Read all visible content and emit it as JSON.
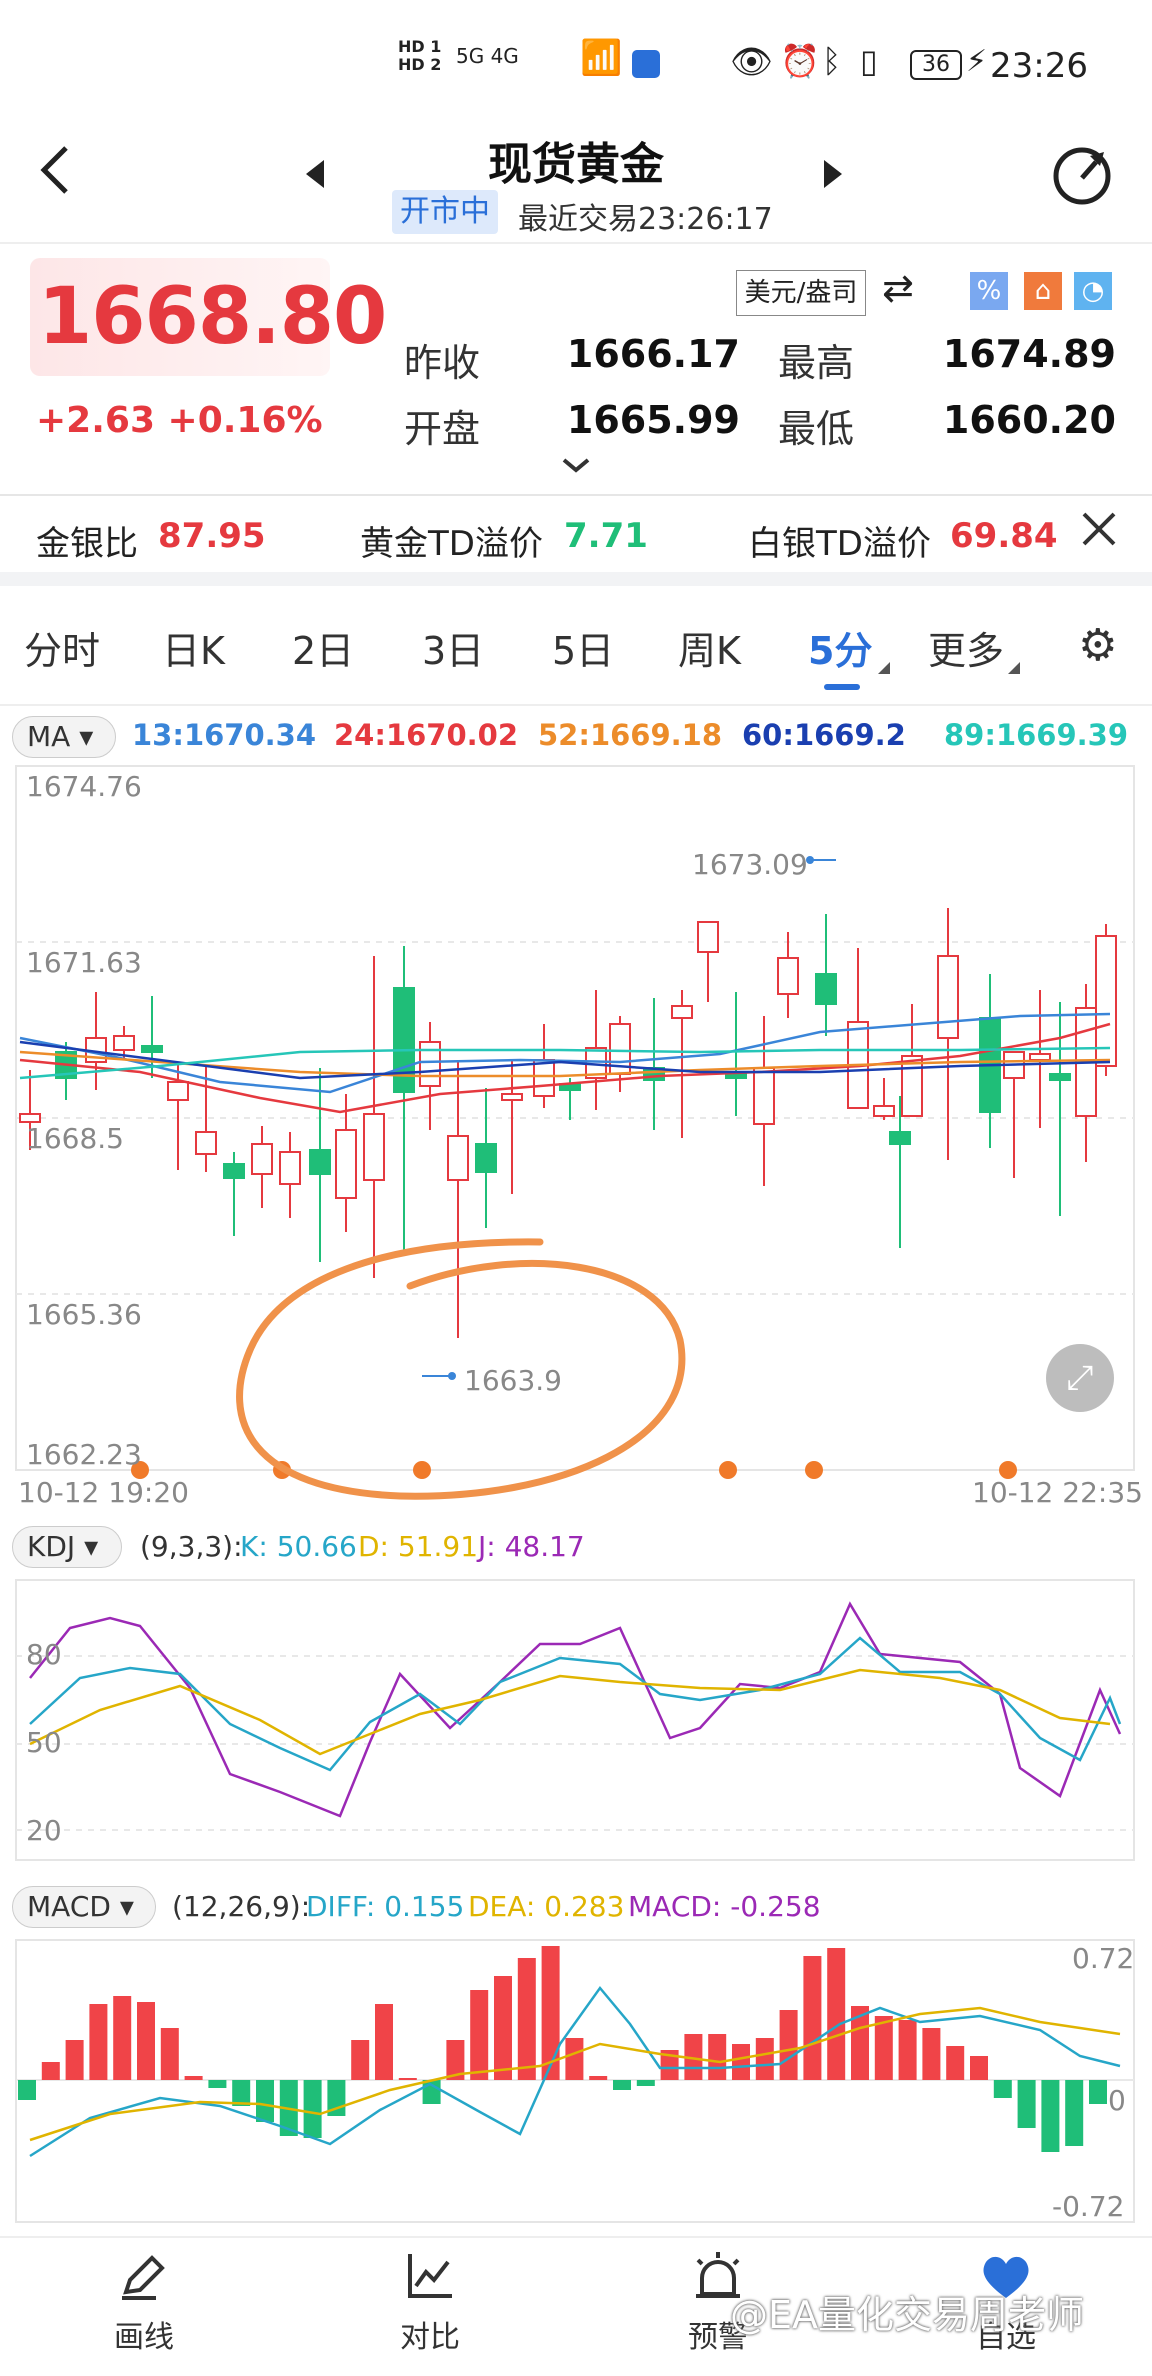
{
  "status_bar": {
    "time": "23:26",
    "battery": "36",
    "network": "5G 4G",
    "hd": "HD"
  },
  "header": {
    "title": "现货黄金",
    "market_status": "开市中",
    "last_trade": "最近交易23:26:17"
  },
  "quote": {
    "price": "1668.80",
    "change": "+2.63",
    "change_pct": "+0.16%",
    "unit": "美元/盎司",
    "prev_close_label": "昨收",
    "prev_close": "1666.17",
    "high_label": "最高",
    "high": "1674.89",
    "open_label": "开盘",
    "open": "1665.99",
    "low_label": "最低",
    "low": "1660.20"
  },
  "ratios": {
    "gold_silver_label": "金银比",
    "gold_silver": "87.95",
    "gold_td_label": "黄金TD溢价",
    "gold_td": "7.71",
    "silver_td_label": "白银TD溢价",
    "silver_td": "69.84"
  },
  "tabs": [
    "分时",
    "日K",
    "2日",
    "3日",
    "5日",
    "周K",
    "5分",
    "更多"
  ],
  "active_tab": "5分",
  "ma": {
    "label": "MA",
    "values": [
      {
        "text": "13:1670.34",
        "color": "#3a85d8"
      },
      {
        "text": "24:1670.02",
        "color": "#e5393f"
      },
      {
        "text": "52:1669.18",
        "color": "#ec8c2a"
      },
      {
        "text": "60:1669.2",
        "color": "#1a3fb0"
      },
      {
        "text": "89:1669.39",
        "color": "#26c6b8"
      }
    ]
  },
  "main_chart": {
    "y_labels": [
      "1674.76",
      "1671.63",
      "1668.5",
      "1665.36",
      "1662.23"
    ],
    "x_start": "10-12 19:20",
    "x_end": "10-12 22:35",
    "max_mark": "1673.09",
    "min_mark": "1663.9"
  },
  "kdj": {
    "label": "KDJ",
    "params": "(9,3,3):",
    "k": "K: 50.66",
    "d": "D: 51.91",
    "j": "J: 48.17",
    "y_labels": [
      "80",
      "50",
      "20"
    ]
  },
  "macd": {
    "label": "MACD",
    "params": "(12,26,9):",
    "diff": "DIFF: 0.155",
    "dea": "DEA: 0.283",
    "macd": "MACD: -0.258",
    "y_labels": [
      "0.72",
      "0",
      "-0.72"
    ]
  },
  "bottom_nav": [
    {
      "label": "画线",
      "icon": "pencil-icon"
    },
    {
      "label": "对比",
      "icon": "compare-chart-icon"
    },
    {
      "label": "预警",
      "icon": "alarm-icon"
    },
    {
      "label": "自选",
      "icon": "heart-icon"
    }
  ],
  "watermark": "@EA量化交易周老师",
  "colors": {
    "up": "#e5393f",
    "down": "#1fbe78",
    "accent": "#2a6fd8"
  }
}
